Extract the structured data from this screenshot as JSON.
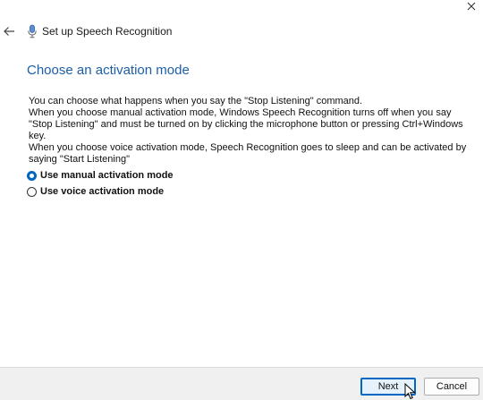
{
  "window": {
    "title": "Set up Speech Recognition"
  },
  "icons": {
    "close": "close-icon",
    "back": "back-arrow-icon",
    "app": "microphone-icon",
    "cursor": "mouse-pointer-icon"
  },
  "page": {
    "heading": "Choose an activation mode",
    "description": [
      "You can choose what happens when you say the \"Stop Listening\" command.",
      "When you choose manual activation mode, Windows Speech Recognition turns off when you say \"Stop Listening\" and must be turned on by clicking the microphone button or pressing Ctrl+Windows key.",
      "When you choose voice activation mode, Speech Recognition goes to sleep and can be activated by saying \"Start Listening\""
    ]
  },
  "options": [
    {
      "label": "Use manual activation mode",
      "selected": true
    },
    {
      "label": "Use voice activation mode",
      "selected": false
    }
  ],
  "footer": {
    "next_label": "Next",
    "cancel_label": "Cancel"
  },
  "colors": {
    "heading": "#1c5fa8",
    "accent": "#0067c0",
    "footer_bg": "#f0f0f0"
  }
}
